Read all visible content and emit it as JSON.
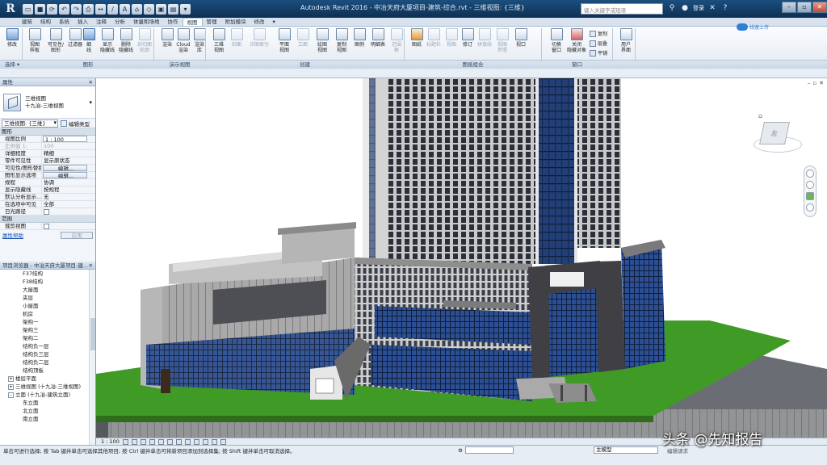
{
  "app": {
    "logo": "R",
    "window_title": "Autodesk Revit 2016 -   中冶天府大厦项目-建筑-综合.rvt - 三维视图: {三维}",
    "search_placeholder": "键入关键字或短语",
    "login_label": "登录",
    "qat_icons": [
      "open-icon",
      "save-icon",
      "undo-icon",
      "redo-icon",
      "print-icon",
      "measure-icon",
      "text-icon",
      "3d-view-icon",
      "section-icon",
      "close-hidden-icon",
      "switch-windows-icon"
    ]
  },
  "ribbon": {
    "tabs": [
      "建筑",
      "结构",
      "系统",
      "插入",
      "注释",
      "分析",
      "体量和场地",
      "协作",
      "视图",
      "管理",
      "附加模块",
      "修改"
    ],
    "active_tab": "视图",
    "buttons": {
      "modify": "修改",
      "view_templates": "视图\n样板",
      "visibility": "可见性/\n图形",
      "filters": "过滤器",
      "thin_lines": "细\n线",
      "show_hidden": "显示\n隐藏线",
      "remove_hidden": "删除\n隐藏线",
      "cut_profile": "剖切面\n轮廓",
      "render": "渲染",
      "cloud_render": "Cloud\n渲染",
      "render_gallery": "渲染\n库",
      "3d_view": "三维\n视图",
      "section": "剖面",
      "callout": "详图索引",
      "plan_views": "平面\n视图",
      "elevation": "立面",
      "drafting_view": "绘图\n视图",
      "duplicate_view": "复制\n视图",
      "legends": "图例",
      "schedules": "明细表",
      "scope_box": "范围\n框",
      "sheet": "图纸",
      "title_block": "标题栏",
      "matchline": "视图",
      "revisions": "修订",
      "guide_grid": "拼接线",
      "view_reference": "视图\n参照",
      "viewports": "视口",
      "switch_windows": "切换\n窗口",
      "close_hidden": "关闭\n隐藏对象",
      "replicate": "复制",
      "cascade": "层叠",
      "tile": "平铺",
      "user_interface": "用户\n界面"
    },
    "groups": [
      "选择 ▾",
      "图形",
      "演示视图",
      "创建",
      "图纸组合",
      "窗口"
    ],
    "share_button": "线速上传"
  },
  "properties": {
    "title": "属性",
    "type_name": "三维视图",
    "type_subname": "十九治-三维视图",
    "selector": "三维视图: {三维}",
    "edit_type": "编辑类型",
    "categories": {
      "graphics": "图形",
      "extents": "范围"
    },
    "rows": [
      {
        "key": "视图比例",
        "value": "1 : 100"
      },
      {
        "key": "比例值 1:",
        "value": "100"
      },
      {
        "key": "详细程度",
        "value": "精细"
      },
      {
        "key": "零件可见性",
        "value": "显示原状态"
      },
      {
        "key": "可见性/图形替换",
        "value": "编辑..."
      },
      {
        "key": "图形显示选项",
        "value": "编辑..."
      },
      {
        "key": "规程",
        "value": "协调"
      },
      {
        "key": "显示隐藏线",
        "value": "按规程"
      },
      {
        "key": "默认分析显示...",
        "value": "无"
      },
      {
        "key": "在选项中可见",
        "value": "全部"
      },
      {
        "key": "日光路径",
        "value": ""
      }
    ],
    "extents_rows": [
      {
        "key": "裁剪视图",
        "value": ""
      }
    ],
    "help_link": "属性帮助",
    "apply": "应用"
  },
  "browser": {
    "title": "项目浏览器 - 中冶天府大厦项目-建...",
    "items": [
      {
        "label": "F37结构",
        "level": 2
      },
      {
        "label": "F38结构",
        "level": 2
      },
      {
        "label": "大屋面",
        "level": 2
      },
      {
        "label": "夹层",
        "level": 2
      },
      {
        "label": "小屋面",
        "level": 2
      },
      {
        "label": "机房",
        "level": 2
      },
      {
        "label": "架构一",
        "level": 2
      },
      {
        "label": "架构三",
        "level": 2
      },
      {
        "label": "架构二",
        "level": 2
      },
      {
        "label": "结构负一层",
        "level": 2
      },
      {
        "label": "结构负三层",
        "level": 2
      },
      {
        "label": "结构负二层",
        "level": 2
      },
      {
        "label": "结构顶板",
        "level": 2
      },
      {
        "label": "楼层平面",
        "level": 1,
        "toggle": "+"
      },
      {
        "label": "三维视图 (十九冶-三维视图)",
        "level": 1,
        "toggle": "+"
      },
      {
        "label": "立面 (十九冶-建筑立面)",
        "level": 1,
        "toggle": "-"
      },
      {
        "label": "东立面",
        "level": 2
      },
      {
        "label": "北立面",
        "level": 2
      },
      {
        "label": "南立面",
        "level": 2
      }
    ]
  },
  "view_control": {
    "scale": "1 : 100"
  },
  "viewcube": {
    "face_label": "左"
  },
  "status": {
    "hint": "单击可进行选择; 按 Tab 键并单击可选择其他项目; 按 Ctrl 键并单击可将新项目添加到选择集; 按 Shift 键并单击可取消选择。",
    "workset_value": "",
    "model": "主模型",
    "right_text": "编辑请求"
  },
  "watermark": "头条 @先知报告",
  "colors": {
    "title_bar": "#15406a",
    "ground": "#3f9a26",
    "glass": "#1f3e78",
    "background": "#ffffff"
  }
}
